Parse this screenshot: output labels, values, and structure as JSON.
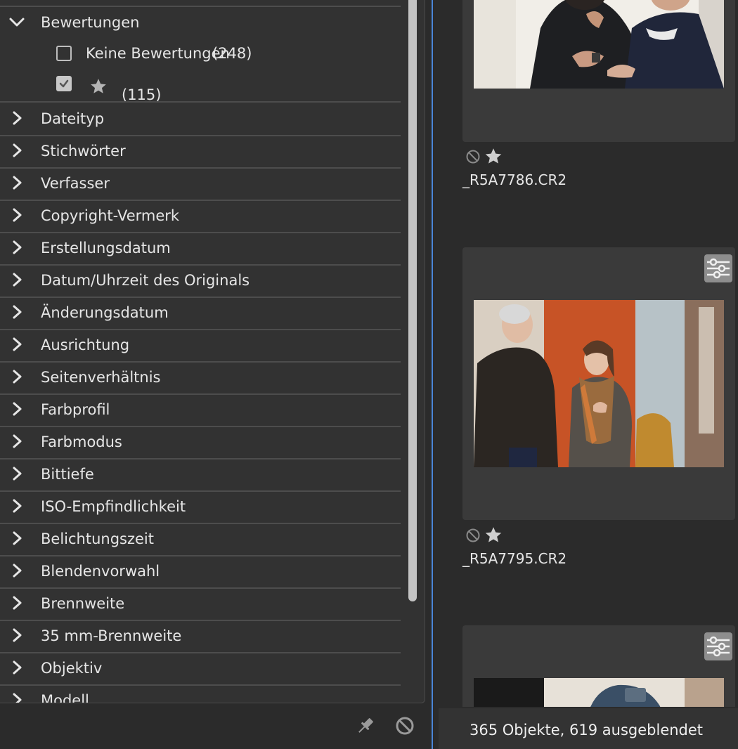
{
  "filter_panel": {
    "expanded_section": {
      "label": "Bewertungen",
      "options": [
        {
          "label": "Keine Bewertungen",
          "count": "(248)",
          "checked": false
        },
        {
          "label": "",
          "icon": "star-icon",
          "count": "(115)",
          "checked": true
        }
      ]
    },
    "sections": [
      "Dateityp",
      "Stichwörter",
      "Verfasser",
      "Copyright-Vermerk",
      "Erstellungsdatum",
      "Datum/Uhrzeit des Originals",
      "Änderungsdatum",
      "Ausrichtung",
      "Seitenverhältnis",
      "Farbprofil",
      "Farbmodus",
      "Bittiefe",
      "ISO-Empfindlichkeit",
      "Belichtungszeit",
      "Blendenvorwahl",
      "Brennweite",
      "35 mm-Brennweite",
      "Objektiv",
      "Modell"
    ],
    "toolbar": {
      "pin_icon": "pin-icon",
      "clear_icon": "clear-filter-icon"
    }
  },
  "content": {
    "items": [
      {
        "filename": "_R5A7786.CR2",
        "reject_icon": "reject-icon",
        "star_icon": "star-icon"
      },
      {
        "filename": "_R5A7795.CR2",
        "reject_icon": "reject-icon",
        "star_icon": "star-icon",
        "adjust_icon": "sliders-icon"
      },
      {
        "filename": "",
        "adjust_icon": "sliders-icon"
      }
    ]
  },
  "status_bar": {
    "text": "365 Objekte, 619 ausgeblendet"
  },
  "colors": {
    "accent_divider": "#4a86d8",
    "panel_bg": "#323232",
    "card_bg": "#3a3a3a"
  }
}
